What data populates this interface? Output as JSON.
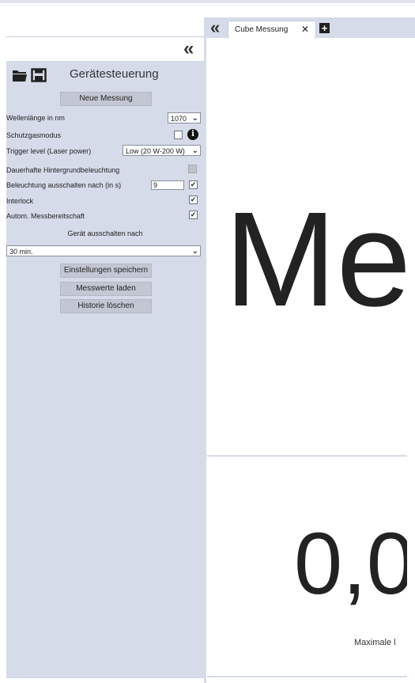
{
  "panel": {
    "title": "Gerätesteuerung",
    "new_measurement": "Neue Messung",
    "wavelength_label": "Wellenlänge in nm",
    "wavelength_value": "1070",
    "protective_gas_label": "Schutzgasmodus",
    "trigger_label": "Trigger level (Laser power)",
    "trigger_value": "Low (20 W-200 W)",
    "backlight_label": "Dauerhafte Hintergrundbeleuchtung",
    "light_off_label": "Beleuchtung ausschalten nach (in s)",
    "light_off_value": "9",
    "interlock_label": "Interlock",
    "auto_ready_label": "Autom. Messbereitschaft",
    "shutdown_label": "Gerät ausschalten nach",
    "shutdown_value": "30 min.",
    "save_settings": "Einstellungen speichern",
    "load_values": "Messwerte laden",
    "clear_history": "Historie löschen",
    "checks": {
      "backlight": false,
      "light_off": true,
      "interlock": true,
      "auto_ready": true,
      "protective_gas": false
    }
  },
  "tabs": [
    {
      "label": "Cube Messung"
    }
  ],
  "main": {
    "title_partial": "Me",
    "value_partial": "0,0",
    "value_label_partial": "Maximale l"
  }
}
